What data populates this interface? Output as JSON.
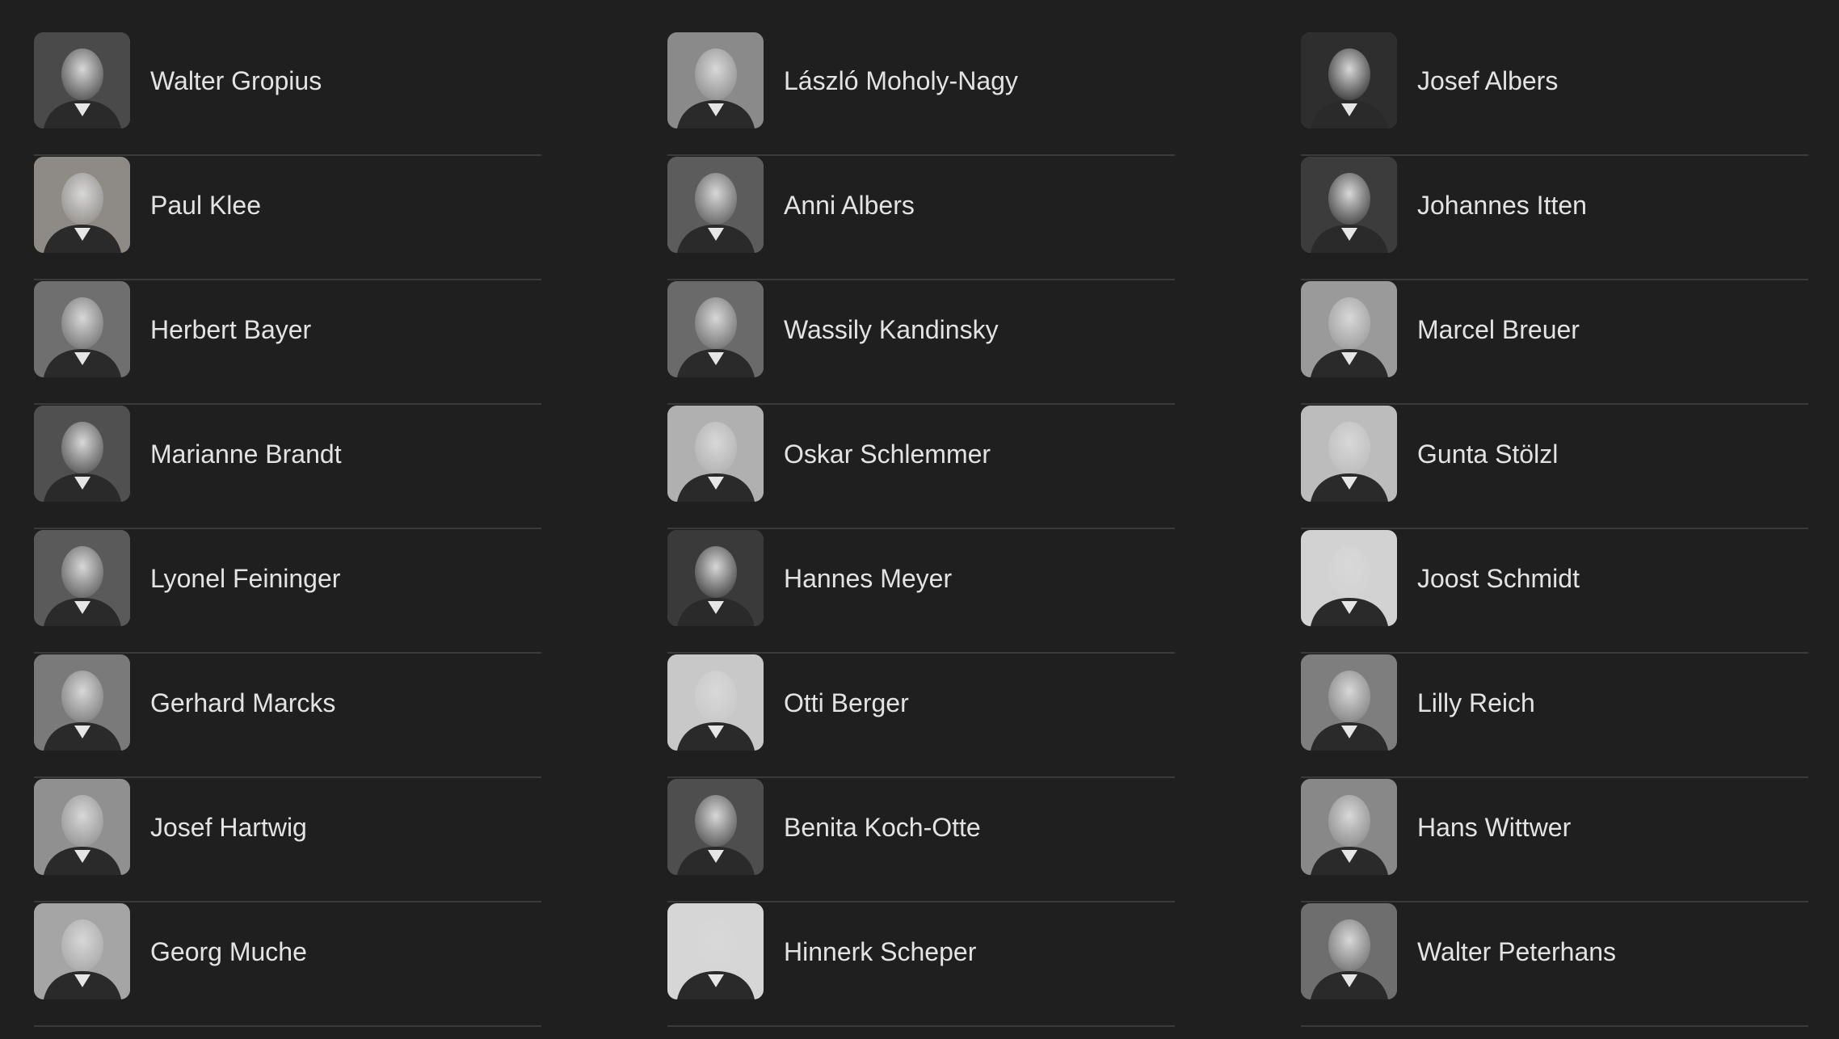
{
  "people": [
    [
      {
        "name": "Walter Gropius",
        "icon": "portrait-photo",
        "tone": "#4a4a4a"
      },
      {
        "name": "Paul Klee",
        "icon": "portrait-photo",
        "tone": "#8e8a86"
      },
      {
        "name": "Herbert Bayer",
        "icon": "portrait-photo",
        "tone": "#6f6f6f"
      },
      {
        "name": "Marianne Brandt",
        "icon": "portrait-photo",
        "tone": "#505050"
      },
      {
        "name": "Lyonel Feininger",
        "icon": "portrait-photo",
        "tone": "#5a5a5a"
      },
      {
        "name": "Gerhard Marcks",
        "icon": "portrait-photo",
        "tone": "#7a7a7a"
      },
      {
        "name": "Josef Hartwig",
        "icon": "portrait-photo",
        "tone": "#909090"
      },
      {
        "name": "Georg Muche",
        "icon": "portrait-photo",
        "tone": "#a5a5a5"
      }
    ],
    [
      {
        "name": "László Moholy-Nagy",
        "icon": "portrait-photo",
        "tone": "#8a8a8a"
      },
      {
        "name": "Anni Albers",
        "icon": "portrait-photo",
        "tone": "#5c5c5c"
      },
      {
        "name": "Wassily Kandinsky",
        "icon": "portrait-photo",
        "tone": "#6a6a6a"
      },
      {
        "name": "Oskar Schlemmer",
        "icon": "portrait-photo",
        "tone": "#b0b0b0"
      },
      {
        "name": "Hannes Meyer",
        "icon": "portrait-photo",
        "tone": "#3a3a3a"
      },
      {
        "name": "Otti Berger",
        "icon": "portrait-photo",
        "tone": "#c8c8c8"
      },
      {
        "name": "Benita Koch-Otte",
        "icon": "portrait-photo",
        "tone": "#4e4e4e"
      },
      {
        "name": "Hinnerk Scheper",
        "icon": "portrait-photo",
        "tone": "#d6d6d6"
      }
    ],
    [
      {
        "name": "Josef Albers",
        "icon": "portrait-photo",
        "tone": "#2e2e2e"
      },
      {
        "name": "Johannes Itten",
        "icon": "portrait-photo",
        "tone": "#3c3c3c"
      },
      {
        "name": "Marcel Breuer",
        "icon": "portrait-photo",
        "tone": "#9a9a9a"
      },
      {
        "name": "Gunta Stölzl",
        "icon": "portrait-photo",
        "tone": "#bcbcbc"
      },
      {
        "name": "Joost Schmidt",
        "icon": "portrait-photo",
        "tone": "#d2d2d2"
      },
      {
        "name": "Lilly Reich",
        "icon": "portrait-photo",
        "tone": "#7e7e7e"
      },
      {
        "name": "Hans Wittwer",
        "icon": "portrait-photo",
        "tone": "#888888"
      },
      {
        "name": "Walter Peterhans",
        "icon": "portrait-photo",
        "tone": "#6e6e6e"
      }
    ]
  ]
}
